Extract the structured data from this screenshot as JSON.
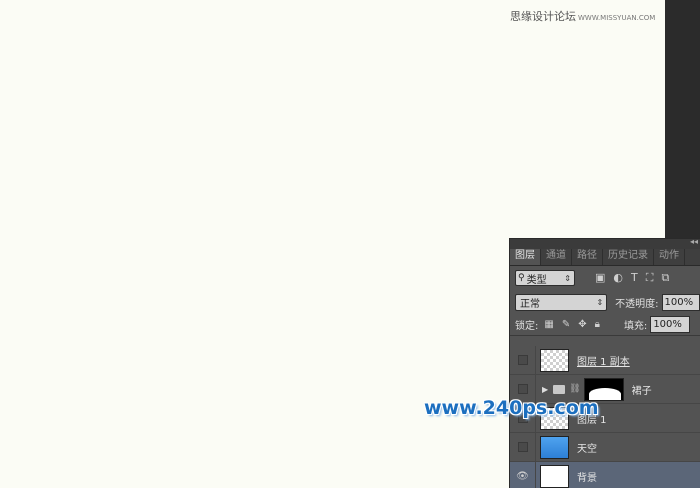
{
  "watermark": {
    "text": "思缘设计论坛",
    "site": "WWW.MISSYUAN.COM"
  },
  "logo_watermark": "www.240ps.com",
  "panel": {
    "tabs": [
      "图层",
      "通道",
      "路径",
      "历史记录",
      "动作"
    ],
    "filter": {
      "label": "类型",
      "icons": [
        "image-filter-icon",
        "adjustment-filter-icon",
        "type-filter-icon",
        "shape-filter-icon",
        "smartobject-filter-icon"
      ]
    },
    "blend_mode": "正常",
    "opacity_label": "不透明度:",
    "opacity_value": "100%",
    "lock_label": "锁定:",
    "fill_label": "填充:",
    "fill_value": "100%",
    "layers": [
      {
        "name": "图层 1 副本",
        "visible": false,
        "thumb": "checker"
      },
      {
        "name": "裙子",
        "visible": false,
        "type": "group"
      },
      {
        "name": "图层 1",
        "visible": false,
        "thumb": "checker"
      },
      {
        "name": "天空",
        "visible": false,
        "thumb": "sky"
      },
      {
        "name": "背景",
        "visible": true,
        "thumb": "white",
        "selected": true
      }
    ]
  },
  "colors": {
    "canvas": "#fbfcf5",
    "panel": "#535353",
    "selected": "#5b6678",
    "logo": "#1c6fbf"
  }
}
